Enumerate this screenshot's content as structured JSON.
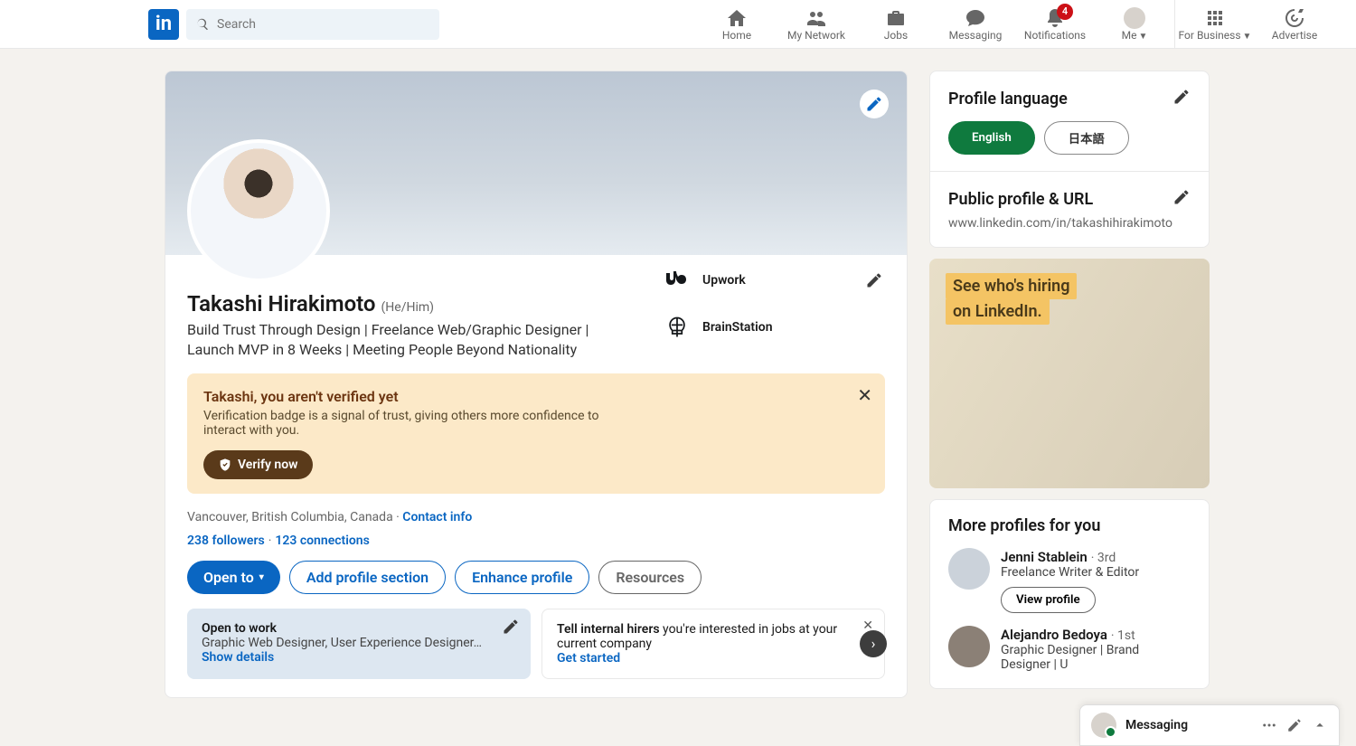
{
  "nav": {
    "search_placeholder": "Search",
    "items": [
      "Home",
      "My Network",
      "Jobs",
      "Messaging",
      "Notifications",
      "Me"
    ],
    "notif_badge": "4",
    "business": "For Business",
    "advertise": "Advertise"
  },
  "profile": {
    "name": "Takashi Hirakimoto",
    "pronouns": "(He/Him)",
    "headline": "Build Trust Through Design | Freelance Web/Graphic Designer | Launch MVP in 8 Weeks | Meeting People Beyond Nationality",
    "companies": [
      {
        "name": "Upwork"
      },
      {
        "name": "BrainStation"
      }
    ],
    "verify": {
      "title": "Takashi, you aren't verified yet",
      "body": "Verification badge is a signal of trust, giving others more confidence to interact with you.",
      "button": "Verify now"
    },
    "location": "Vancouver, British Columbia, Canada",
    "contact": "Contact info",
    "followers": "238 followers",
    "connections": "123 connections",
    "buttons": {
      "open_to": "Open to",
      "add_section": "Add profile section",
      "enhance": "Enhance profile",
      "resources": "Resources"
    },
    "panels": {
      "otw_title": "Open to work",
      "otw_sub": "Graphic Web Designer, User Experience Designer…",
      "otw_link": "Show details",
      "hirers_bold": "Tell internal hirers",
      "hirers_rest": " you're interested in jobs at your current company",
      "hirers_link": "Get started"
    }
  },
  "side": {
    "lang_title": "Profile language",
    "lang_en": "English",
    "lang_jp": "日本語",
    "url_title": "Public profile & URL",
    "url": "www.linkedin.com/in/takashihirakimoto",
    "ad_line1": "See who's hiring",
    "ad_line2": "on LinkedIn.",
    "more_title": "More profiles for you",
    "profiles": [
      {
        "name": "Jenni Stablein",
        "degree": "· 3rd",
        "role": "Freelance Writer & Editor",
        "action": "View profile"
      },
      {
        "name": "Alejandro Bedoya",
        "degree": "· 1st",
        "role": "Graphic Designer | Brand Designer | U"
      }
    ]
  },
  "msg": {
    "title": "Messaging"
  }
}
